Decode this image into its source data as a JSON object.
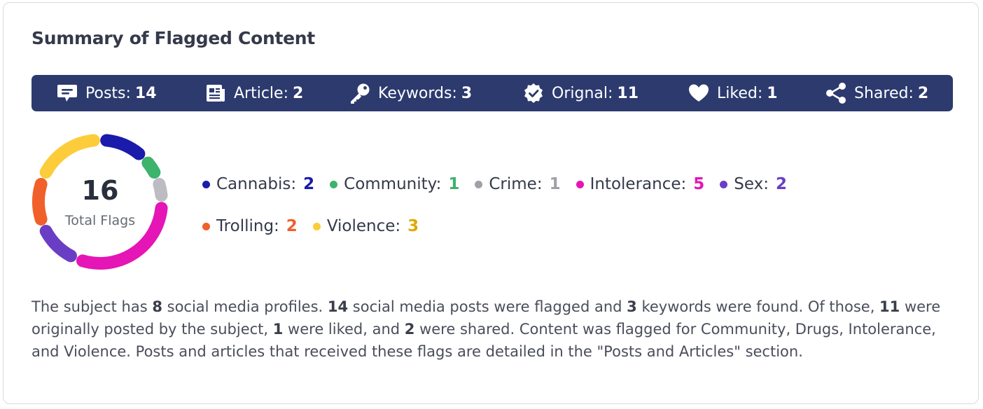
{
  "card": {
    "title": "Summary of Flagged Content"
  },
  "stats": [
    {
      "label": "Posts:",
      "value": "14",
      "icon": "chat-bubble-icon"
    },
    {
      "label": "Article:",
      "value": "2",
      "icon": "newspaper-icon"
    },
    {
      "label": "Keywords:",
      "value": "3",
      "icon": "key-icon"
    },
    {
      "label": "Orignal:",
      "value": "11",
      "icon": "verified-badge-icon"
    },
    {
      "label": "Liked:",
      "value": "1",
      "icon": "heart-icon"
    },
    {
      "label": "Shared:",
      "value": "2",
      "icon": "share-icon"
    }
  ],
  "donut": {
    "total": "16",
    "total_label": "Total Flags",
    "segments": [
      {
        "name": "Cannabis",
        "value": 2,
        "color": "#1a1aab"
      },
      {
        "name": "Community",
        "value": 1,
        "color": "#3db36b"
      },
      {
        "name": "Crime",
        "value": 1,
        "color": "#bcbcc2"
      },
      {
        "name": "Intolerance",
        "value": 5,
        "color": "#e515b6"
      },
      {
        "name": "Sex",
        "value": 2,
        "color": "#6a3ec4"
      },
      {
        "name": "Trolling",
        "value": 2,
        "color": "#f0602a"
      },
      {
        "name": "Violence",
        "value": 3,
        "color": "#fccc3a"
      }
    ]
  },
  "legend": {
    "row1": [
      {
        "label": "Cannabis:",
        "count": "2",
        "color": "#1a1aab",
        "count_color": "#1a1aab"
      },
      {
        "label": "Community:",
        "count": "1",
        "color": "#3db36b",
        "count_color": "#3db36b"
      },
      {
        "label": "Crime:",
        "count": "1",
        "color": "#a0a0a6",
        "count_color": "#a0a0a6"
      },
      {
        "label": "Intolerance:",
        "count": "5",
        "color": "#e515b6",
        "count_color": "#e515b6"
      },
      {
        "label": "Sex:",
        "count": "2",
        "color": "#6a3ec4",
        "count_color": "#6a3ec4"
      }
    ],
    "row2": [
      {
        "label": "Trolling:",
        "count": "2",
        "color": "#f0602a",
        "count_color": "#f0602a"
      },
      {
        "label": "Violence:",
        "count": "3",
        "color": "#fccc3a",
        "count_color": "#e0a800"
      }
    ]
  },
  "summary": {
    "p1": "The subject has ",
    "profiles": "8",
    "p2": " social media profiles. ",
    "posts": "14",
    "p3": " social media posts were flagged and ",
    "keywords": "3",
    "p4": " keywords were found. Of those, ",
    "original": "11",
    "p5": " were originally posted by the subject, ",
    "liked": "1",
    "p6": " were liked, and ",
    "shared": "2",
    "p7": " were shared. Content was flagged for Community, Drugs, Intolerance, and Violence. Posts and articles that received these flags are detailed in the \"Posts and Articles\" section."
  },
  "colors": {
    "bar_bg": "#2c3a6e",
    "title": "#353a4a"
  }
}
